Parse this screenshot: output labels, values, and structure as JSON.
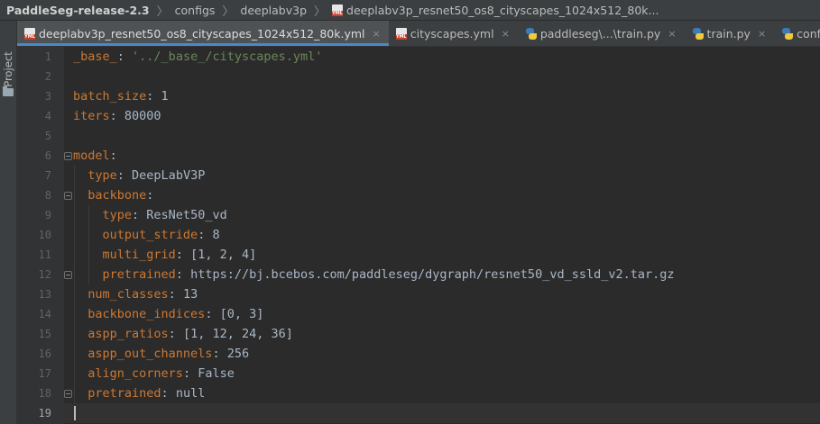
{
  "breadcrumb": {
    "project": "PaddleSeg-release-2.3",
    "folder1": "configs",
    "folder2": "deeplabv3p",
    "file": "deeplabv3p_resnet50_os8_cityscapes_1024x512_80k..."
  },
  "sidebar": {
    "project_label": "Project"
  },
  "tabs": [
    {
      "label": "deeplabv3p_resnet50_os8_cityscapes_1024x512_80k.yml",
      "icon": "yml-file-icon",
      "active": true
    },
    {
      "label": "cityscapes.yml",
      "icon": "yml-file-icon",
      "active": false
    },
    {
      "label": "paddleseg\\...\\train.py",
      "icon": "python-file-icon",
      "active": false
    },
    {
      "label": "train.py",
      "icon": "python-file-icon",
      "active": false
    },
    {
      "label": "config.py",
      "icon": "python-file-icon",
      "active": false
    }
  ],
  "tab_close_glyph": "×",
  "editor": {
    "line_numbers": [
      "1",
      "2",
      "3",
      "4",
      "5",
      "6",
      "7",
      "8",
      "9",
      "10",
      "11",
      "12",
      "13",
      "14",
      "15",
      "16",
      "17",
      "18",
      "19"
    ],
    "lines": [
      {
        "indent": "",
        "key": "_base_",
        "sep": ": ",
        "value": "'../_base_/cityscapes.yml'",
        "value_type": "string"
      },
      {
        "indent": "",
        "key": "",
        "sep": "",
        "value": "",
        "value_type": "plain"
      },
      {
        "indent": "",
        "key": "batch_size",
        "sep": ": ",
        "value": "1",
        "value_type": "plain"
      },
      {
        "indent": "",
        "key": "iters",
        "sep": ": ",
        "value": "80000",
        "value_type": "plain"
      },
      {
        "indent": "",
        "key": "",
        "sep": "",
        "value": "",
        "value_type": "plain"
      },
      {
        "indent": "",
        "key": "model",
        "sep": ":",
        "value": "",
        "value_type": "plain"
      },
      {
        "indent": "  ",
        "key": "type",
        "sep": ": ",
        "value": "DeepLabV3P",
        "value_type": "plain"
      },
      {
        "indent": "  ",
        "key": "backbone",
        "sep": ":",
        "value": "",
        "value_type": "plain"
      },
      {
        "indent": "    ",
        "key": "type",
        "sep": ": ",
        "value": "ResNet50_vd",
        "value_type": "plain"
      },
      {
        "indent": "    ",
        "key": "output_stride",
        "sep": ": ",
        "value": "8",
        "value_type": "plain"
      },
      {
        "indent": "    ",
        "key": "multi_grid",
        "sep": ": ",
        "value": "[1, 2, 4]",
        "value_type": "plain"
      },
      {
        "indent": "    ",
        "key": "pretrained",
        "sep": ": ",
        "value": "https://bj.bcebos.com/paddleseg/dygraph/resnet50_vd_ssld_v2.tar.gz",
        "value_type": "plain"
      },
      {
        "indent": "  ",
        "key": "num_classes",
        "sep": ": ",
        "value": "13",
        "value_type": "plain"
      },
      {
        "indent": "  ",
        "key": "backbone_indices",
        "sep": ": ",
        "value": "[0, 3]",
        "value_type": "plain"
      },
      {
        "indent": "  ",
        "key": "aspp_ratios",
        "sep": ": ",
        "value": "[1, 12, 24, 36]",
        "value_type": "plain"
      },
      {
        "indent": "  ",
        "key": "aspp_out_channels",
        "sep": ": ",
        "value": "256",
        "value_type": "plain"
      },
      {
        "indent": "  ",
        "key": "align_corners",
        "sep": ": ",
        "value": "False",
        "value_type": "plain"
      },
      {
        "indent": "  ",
        "key": "pretrained",
        "sep": ": ",
        "value": "null",
        "value_type": "plain"
      },
      {
        "indent": "",
        "key": "",
        "sep": "",
        "value": "",
        "value_type": "plain"
      }
    ],
    "current_line": "19"
  },
  "colors": {
    "key": "#cc7832",
    "string": "#6a8759",
    "plain": "#a9b7c6",
    "background": "#2b2b2b",
    "accent": "#4a88c7"
  }
}
